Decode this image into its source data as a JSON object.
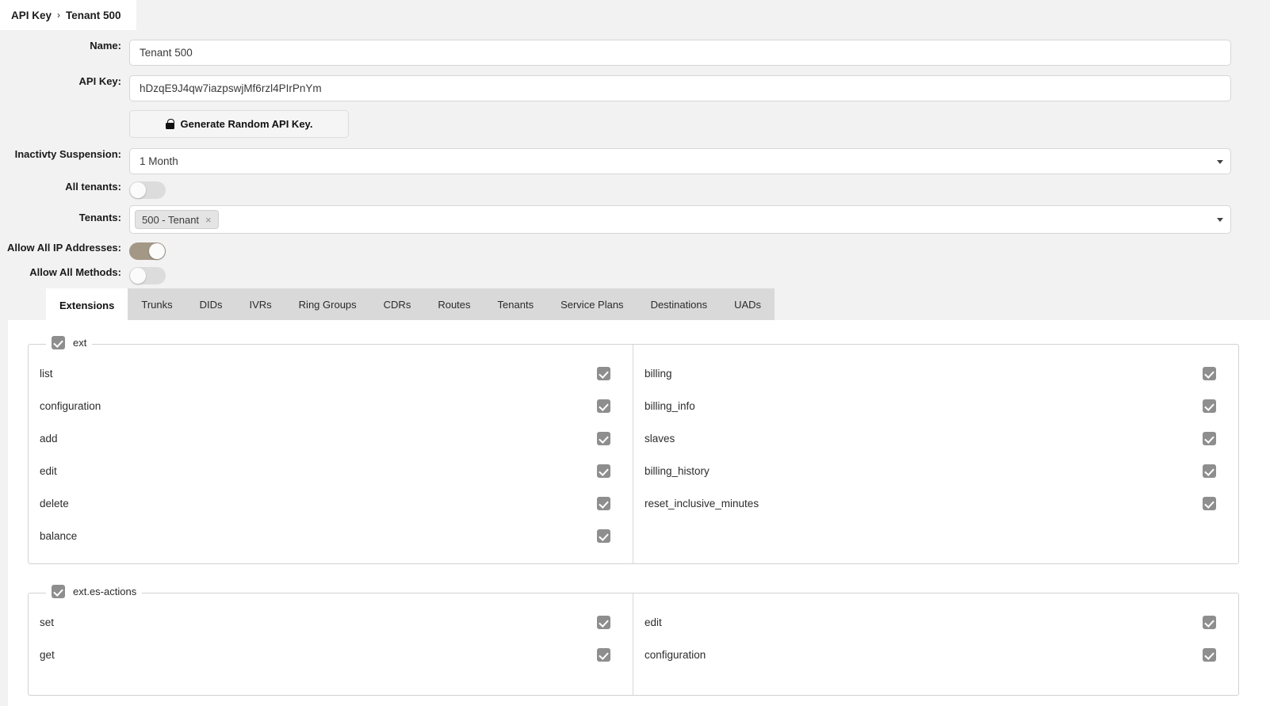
{
  "breadcrumb": {
    "root": "API Key",
    "separator": "›",
    "current": "Tenant 500"
  },
  "form": {
    "name": {
      "label": "Name:",
      "value": "Tenant 500"
    },
    "api_key": {
      "label": "API Key:",
      "value": "hDzqE9J4qw7iazpswjMf6rzl4PIrPnYm"
    },
    "generate_button": {
      "label": "Generate Random API Key.",
      "icon": "lock-icon"
    },
    "inactivity": {
      "label": "Inactivty Suspension:",
      "value": "1 Month"
    },
    "all_tenants": {
      "label": "All tenants:",
      "state": "off"
    },
    "tenants": {
      "label": "Tenants:",
      "tag": "500 - Tenant",
      "remove_icon": "×"
    },
    "allow_all_ip": {
      "label": "Allow All IP Addresses:",
      "state": "on"
    },
    "allow_all_methods": {
      "label": "Allow All Methods:",
      "state": "off"
    }
  },
  "colors": {
    "toggle_on": "#a39786",
    "toggle_off": "#dcdcdc",
    "checkbox": "#8e8e8e",
    "panel_bg": "#f2f2f2",
    "tab_bg": "#d9d9d9"
  },
  "tabs": [
    {
      "label": "Extensions",
      "active": true
    },
    {
      "label": "Trunks",
      "active": false
    },
    {
      "label": "DIDs",
      "active": false
    },
    {
      "label": "IVRs",
      "active": false
    },
    {
      "label": "Ring Groups",
      "active": false
    },
    {
      "label": "CDRs",
      "active": false
    },
    {
      "label": "Routes",
      "active": false
    },
    {
      "label": "Tenants",
      "active": false
    },
    {
      "label": "Service Plans",
      "active": false
    },
    {
      "label": "Destinations",
      "active": false
    },
    {
      "label": "UADs",
      "active": false
    }
  ],
  "groups": [
    {
      "title": "ext",
      "checked": true,
      "left": [
        {
          "label": "list",
          "checked": true
        },
        {
          "label": "configuration",
          "checked": true
        },
        {
          "label": "add",
          "checked": true
        },
        {
          "label": "edit",
          "checked": true
        },
        {
          "label": "delete",
          "checked": true
        },
        {
          "label": "balance",
          "checked": true
        }
      ],
      "right": [
        {
          "label": "billing",
          "checked": true
        },
        {
          "label": "billing_info",
          "checked": true
        },
        {
          "label": "slaves",
          "checked": true
        },
        {
          "label": "billing_history",
          "checked": true
        },
        {
          "label": "reset_inclusive_minutes",
          "checked": true
        }
      ]
    },
    {
      "title": "ext.es-actions",
      "checked": true,
      "left": [
        {
          "label": "set",
          "checked": true
        },
        {
          "label": "get",
          "checked": true
        }
      ],
      "right": [
        {
          "label": "edit",
          "checked": true
        },
        {
          "label": "configuration",
          "checked": true
        }
      ]
    }
  ]
}
